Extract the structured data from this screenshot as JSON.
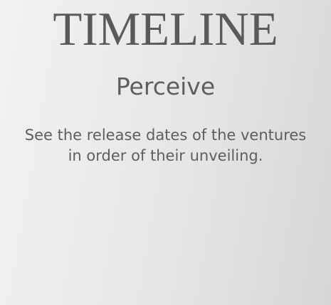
{
  "panel": {
    "title": "TIMELINE",
    "subtitle": "Perceive",
    "description": "See the release dates of the ventures in order of their unveiling."
  },
  "colors": {
    "text": "#5b5b5e",
    "background_light": "#f2f2f2",
    "background_dark": "#d6d6d6"
  }
}
